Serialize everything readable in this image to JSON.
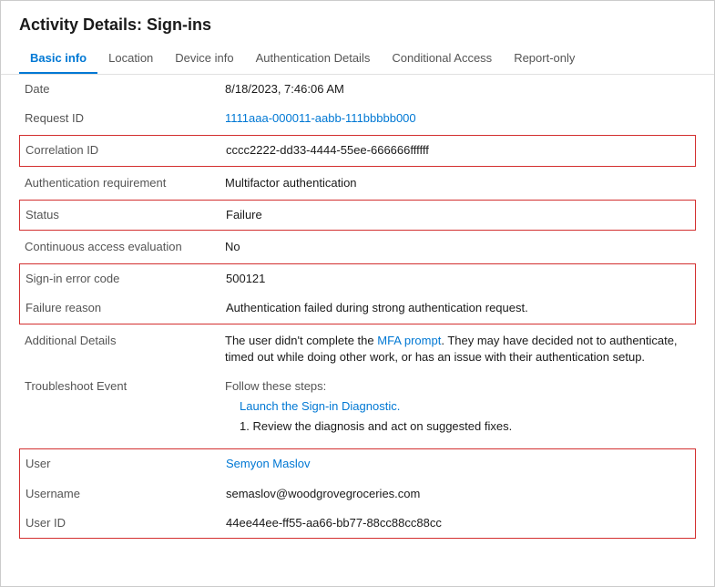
{
  "title": "Activity Details: Sign-ins",
  "tabs": [
    {
      "id": "basic-info",
      "label": "Basic info",
      "active": true
    },
    {
      "id": "location",
      "label": "Location",
      "active": false
    },
    {
      "id": "device-info",
      "label": "Device info",
      "active": false
    },
    {
      "id": "authentication-details",
      "label": "Authentication Details",
      "active": false
    },
    {
      "id": "conditional-access",
      "label": "Conditional Access",
      "active": false
    },
    {
      "id": "report-only",
      "label": "Report-only",
      "active": false
    }
  ],
  "fields": {
    "date_label": "Date",
    "date_value": "8/18/2023, 7:46:06 AM",
    "request_id_label": "Request ID",
    "request_id_value": "1111aaa-000011-aabb-111bbbbb000",
    "correlation_id_label": "Correlation ID",
    "correlation_id_value": "cccc2222-dd33-4444-55ee-666666ffffff",
    "auth_req_label": "Authentication requirement",
    "auth_req_value": "Multifactor authentication",
    "status_label": "Status",
    "status_value": "Failure",
    "continuous_label": "Continuous access evaluation",
    "continuous_value": "No",
    "error_code_label": "Sign-in error code",
    "error_code_value": "500121",
    "failure_reason_label": "Failure reason",
    "failure_reason_value": "Authentication failed during strong authentication request.",
    "additional_details_label": "Additional Details",
    "additional_details_part1": "The user didn't complete the ",
    "additional_details_link": "MFA prompt",
    "additional_details_part2": ". They may have decided not to authenticate, timed out while doing other work, or has an issue with their authentication setup.",
    "troubleshoot_label": "Troubleshoot Event",
    "troubleshoot_follow": "Follow these steps:",
    "troubleshoot_link": "Launch the Sign-in Diagnostic.",
    "troubleshoot_step1": "1. Review the diagnosis and act on suggested fixes.",
    "user_label": "User",
    "user_value": "Semyon Maslov",
    "username_label": "Username",
    "username_value": "semaslov@woodgrovegroceries.com",
    "user_id_label": "User ID",
    "user_id_value": "44ee44ee-ff55-aa66-bb77-88cc88cc88cc"
  },
  "colors": {
    "active_tab": "#0078d4",
    "link": "#0078d4",
    "red_border": "#d32f2f",
    "label_color": "#555555"
  }
}
